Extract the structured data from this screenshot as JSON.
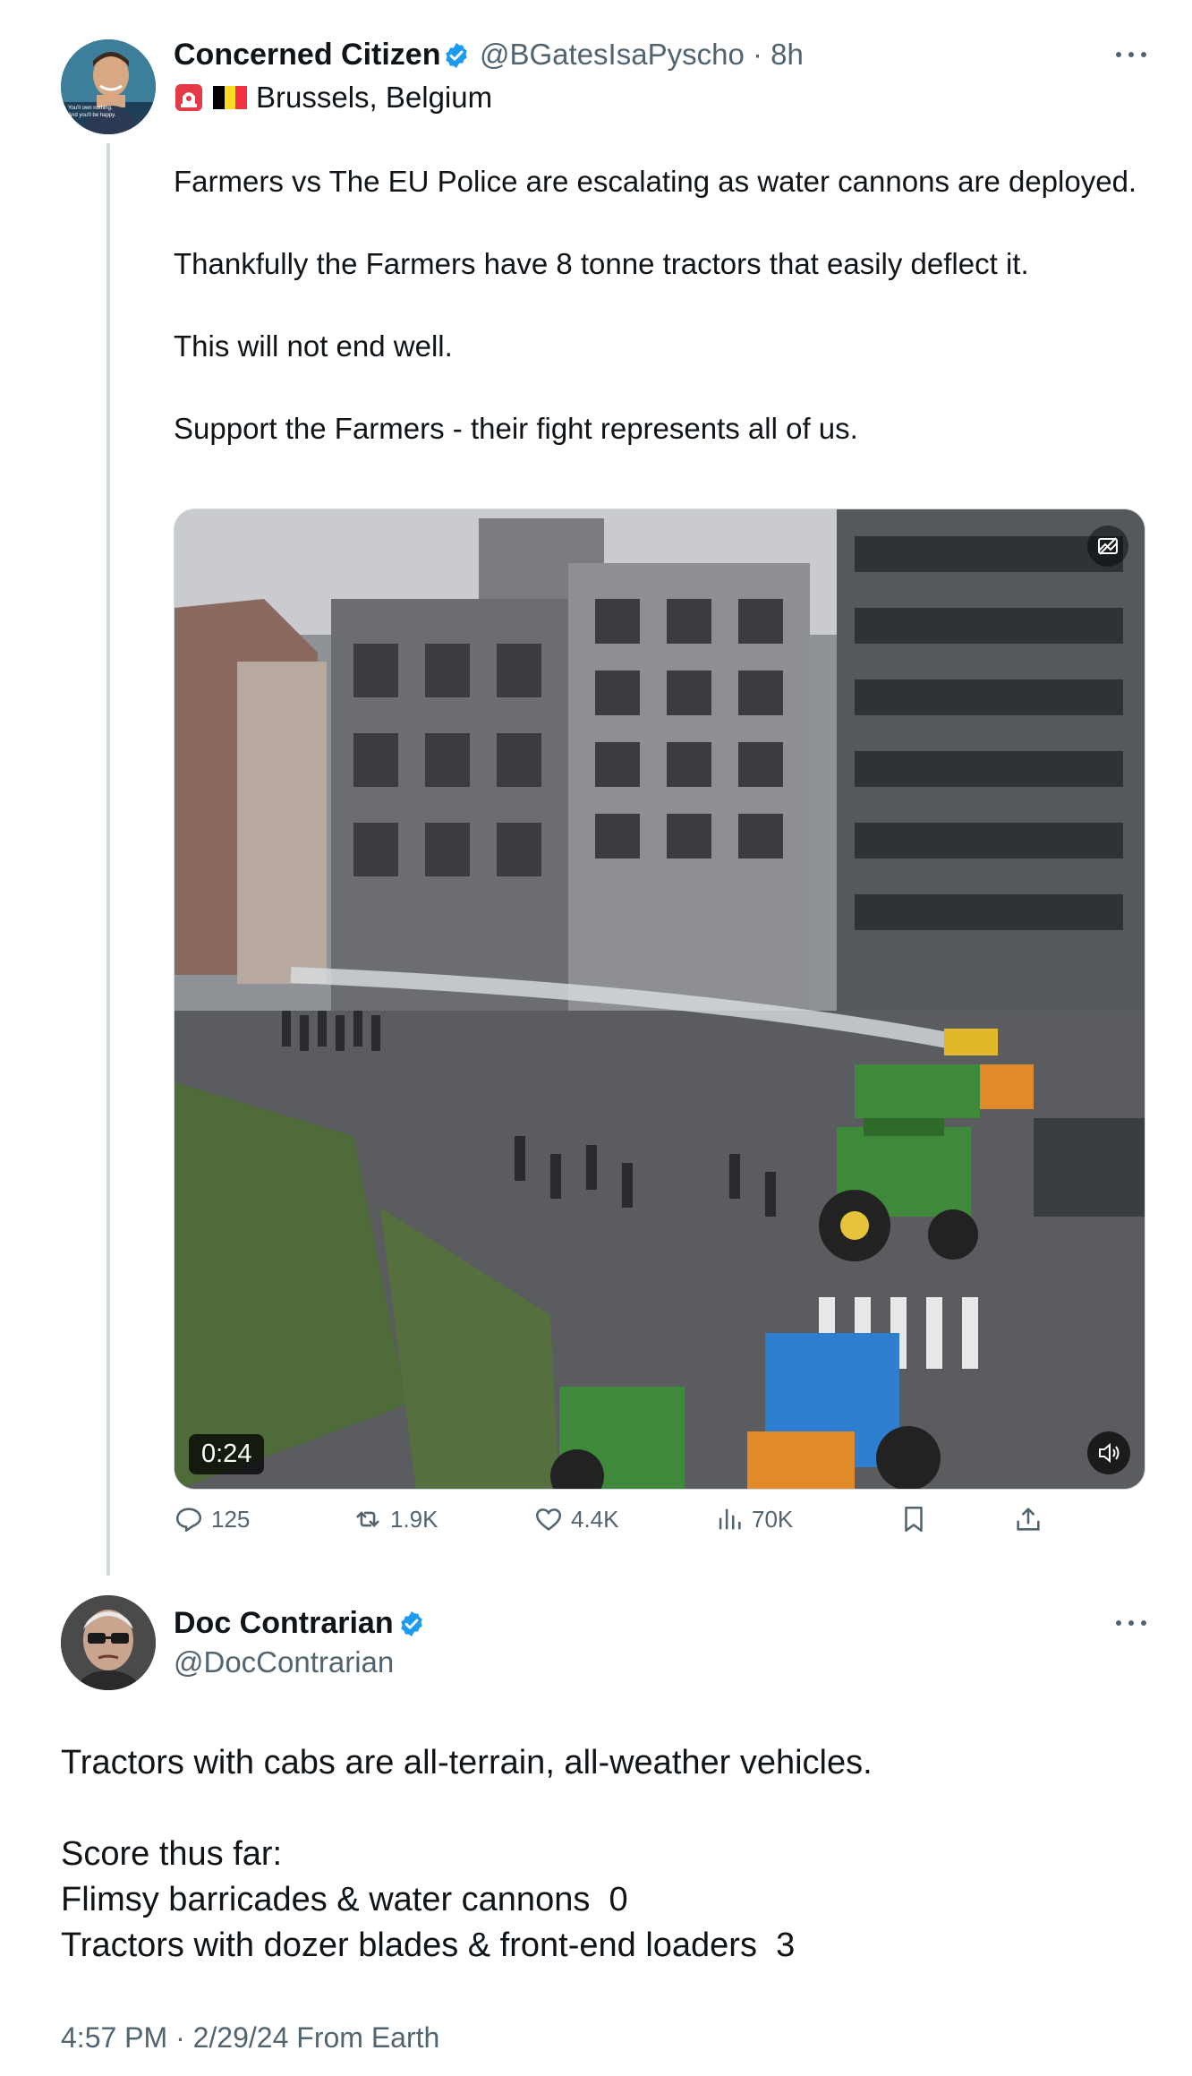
{
  "tweet1": {
    "display_name": "Concerned Citizen",
    "handle_time": "@BGatesIsaPyscho · 8h",
    "location": "Brussels, Belgium",
    "paragraphs": [
      "Farmers vs The EU Police are escalating as water cannons are deployed.",
      "Thankfully the Farmers have 8 tonne tractors that easily deflect it.",
      "This will not end well.",
      "Support the Farmers - their fight represents all of us."
    ],
    "video": {
      "duration": "0:24",
      "sound_icon": "speaker-muted-icon",
      "alt_icon": "media-settings-icon"
    },
    "actions": {
      "replies": "125",
      "reposts": "1.9K",
      "likes": "4.4K",
      "views": "70K"
    },
    "avatar_caption": [
      "You'll own nothing.",
      "And you'll be happy."
    ]
  },
  "tweet2": {
    "display_name": "Doc Contrarian",
    "handle": "@DocContrarian",
    "text": "Tractors with cabs are all-terrain, all-weather vehicles.\n\nScore thus far:\nFlimsy barricades & water cannons  0\nTractors with dozer blades & front-end loaders  3",
    "timestamp": "4:57 PM · 2/29/24 From Earth"
  },
  "colors": {
    "text": "#0f1419",
    "secondary": "#536471",
    "verified": "#1d9bf0",
    "thread_line": "#cfd9de"
  }
}
